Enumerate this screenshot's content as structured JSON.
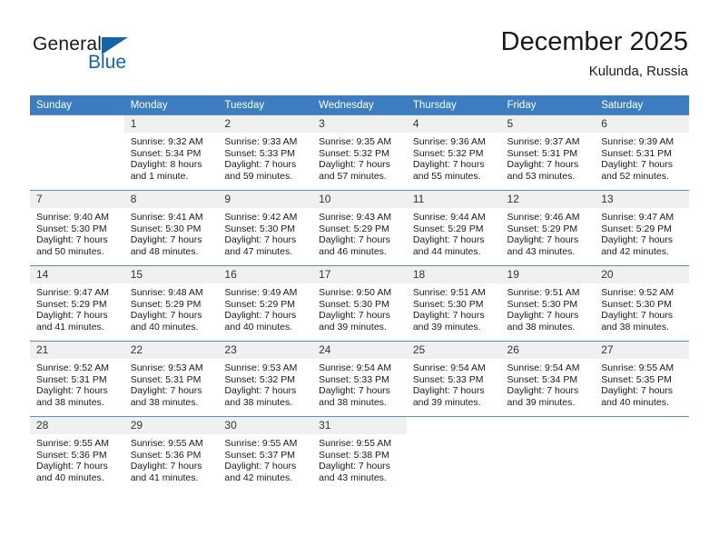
{
  "brand": {
    "line1": "General",
    "line2": "Blue",
    "triangle_color": "#1464aa"
  },
  "header": {
    "title": "December 2025",
    "subtitle": "Kulunda, Russia"
  },
  "theme": {
    "header_bg": "#3b7dc0",
    "daynum_bg": "#f0f0f0",
    "grid_line": "#5a8fc8",
    "text": "#1a1a1a"
  },
  "weekdays": [
    "Sunday",
    "Monday",
    "Tuesday",
    "Wednesday",
    "Thursday",
    "Friday",
    "Saturday"
  ],
  "weeks": [
    [
      {
        "empty": true
      },
      {
        "day": "1",
        "sunrise": "Sunrise: 9:32 AM",
        "sunset": "Sunset: 5:34 PM",
        "daylight": "Daylight: 8 hours and 1 minute."
      },
      {
        "day": "2",
        "sunrise": "Sunrise: 9:33 AM",
        "sunset": "Sunset: 5:33 PM",
        "daylight": "Daylight: 7 hours and 59 minutes."
      },
      {
        "day": "3",
        "sunrise": "Sunrise: 9:35 AM",
        "sunset": "Sunset: 5:32 PM",
        "daylight": "Daylight: 7 hours and 57 minutes."
      },
      {
        "day": "4",
        "sunrise": "Sunrise: 9:36 AM",
        "sunset": "Sunset: 5:32 PM",
        "daylight": "Daylight: 7 hours and 55 minutes."
      },
      {
        "day": "5",
        "sunrise": "Sunrise: 9:37 AM",
        "sunset": "Sunset: 5:31 PM",
        "daylight": "Daylight: 7 hours and 53 minutes."
      },
      {
        "day": "6",
        "sunrise": "Sunrise: 9:39 AM",
        "sunset": "Sunset: 5:31 PM",
        "daylight": "Daylight: 7 hours and 52 minutes."
      }
    ],
    [
      {
        "day": "7",
        "sunrise": "Sunrise: 9:40 AM",
        "sunset": "Sunset: 5:30 PM",
        "daylight": "Daylight: 7 hours and 50 minutes."
      },
      {
        "day": "8",
        "sunrise": "Sunrise: 9:41 AM",
        "sunset": "Sunset: 5:30 PM",
        "daylight": "Daylight: 7 hours and 48 minutes."
      },
      {
        "day": "9",
        "sunrise": "Sunrise: 9:42 AM",
        "sunset": "Sunset: 5:30 PM",
        "daylight": "Daylight: 7 hours and 47 minutes."
      },
      {
        "day": "10",
        "sunrise": "Sunrise: 9:43 AM",
        "sunset": "Sunset: 5:29 PM",
        "daylight": "Daylight: 7 hours and 46 minutes."
      },
      {
        "day": "11",
        "sunrise": "Sunrise: 9:44 AM",
        "sunset": "Sunset: 5:29 PM",
        "daylight": "Daylight: 7 hours and 44 minutes."
      },
      {
        "day": "12",
        "sunrise": "Sunrise: 9:46 AM",
        "sunset": "Sunset: 5:29 PM",
        "daylight": "Daylight: 7 hours and 43 minutes."
      },
      {
        "day": "13",
        "sunrise": "Sunrise: 9:47 AM",
        "sunset": "Sunset: 5:29 PM",
        "daylight": "Daylight: 7 hours and 42 minutes."
      }
    ],
    [
      {
        "day": "14",
        "sunrise": "Sunrise: 9:47 AM",
        "sunset": "Sunset: 5:29 PM",
        "daylight": "Daylight: 7 hours and 41 minutes."
      },
      {
        "day": "15",
        "sunrise": "Sunrise: 9:48 AM",
        "sunset": "Sunset: 5:29 PM",
        "daylight": "Daylight: 7 hours and 40 minutes."
      },
      {
        "day": "16",
        "sunrise": "Sunrise: 9:49 AM",
        "sunset": "Sunset: 5:29 PM",
        "daylight": "Daylight: 7 hours and 40 minutes."
      },
      {
        "day": "17",
        "sunrise": "Sunrise: 9:50 AM",
        "sunset": "Sunset: 5:30 PM",
        "daylight": "Daylight: 7 hours and 39 minutes."
      },
      {
        "day": "18",
        "sunrise": "Sunrise: 9:51 AM",
        "sunset": "Sunset: 5:30 PM",
        "daylight": "Daylight: 7 hours and 39 minutes."
      },
      {
        "day": "19",
        "sunrise": "Sunrise: 9:51 AM",
        "sunset": "Sunset: 5:30 PM",
        "daylight": "Daylight: 7 hours and 38 minutes."
      },
      {
        "day": "20",
        "sunrise": "Sunrise: 9:52 AM",
        "sunset": "Sunset: 5:30 PM",
        "daylight": "Daylight: 7 hours and 38 minutes."
      }
    ],
    [
      {
        "day": "21",
        "sunrise": "Sunrise: 9:52 AM",
        "sunset": "Sunset: 5:31 PM",
        "daylight": "Daylight: 7 hours and 38 minutes."
      },
      {
        "day": "22",
        "sunrise": "Sunrise: 9:53 AM",
        "sunset": "Sunset: 5:31 PM",
        "daylight": "Daylight: 7 hours and 38 minutes."
      },
      {
        "day": "23",
        "sunrise": "Sunrise: 9:53 AM",
        "sunset": "Sunset: 5:32 PM",
        "daylight": "Daylight: 7 hours and 38 minutes."
      },
      {
        "day": "24",
        "sunrise": "Sunrise: 9:54 AM",
        "sunset": "Sunset: 5:33 PM",
        "daylight": "Daylight: 7 hours and 38 minutes."
      },
      {
        "day": "25",
        "sunrise": "Sunrise: 9:54 AM",
        "sunset": "Sunset: 5:33 PM",
        "daylight": "Daylight: 7 hours and 39 minutes."
      },
      {
        "day": "26",
        "sunrise": "Sunrise: 9:54 AM",
        "sunset": "Sunset: 5:34 PM",
        "daylight": "Daylight: 7 hours and 39 minutes."
      },
      {
        "day": "27",
        "sunrise": "Sunrise: 9:55 AM",
        "sunset": "Sunset: 5:35 PM",
        "daylight": "Daylight: 7 hours and 40 minutes."
      }
    ],
    [
      {
        "day": "28",
        "sunrise": "Sunrise: 9:55 AM",
        "sunset": "Sunset: 5:36 PM",
        "daylight": "Daylight: 7 hours and 40 minutes."
      },
      {
        "day": "29",
        "sunrise": "Sunrise: 9:55 AM",
        "sunset": "Sunset: 5:36 PM",
        "daylight": "Daylight: 7 hours and 41 minutes."
      },
      {
        "day": "30",
        "sunrise": "Sunrise: 9:55 AM",
        "sunset": "Sunset: 5:37 PM",
        "daylight": "Daylight: 7 hours and 42 minutes."
      },
      {
        "day": "31",
        "sunrise": "Sunrise: 9:55 AM",
        "sunset": "Sunset: 5:38 PM",
        "daylight": "Daylight: 7 hours and 43 minutes."
      },
      {
        "empty": true
      },
      {
        "empty": true
      },
      {
        "empty": true
      }
    ]
  ]
}
